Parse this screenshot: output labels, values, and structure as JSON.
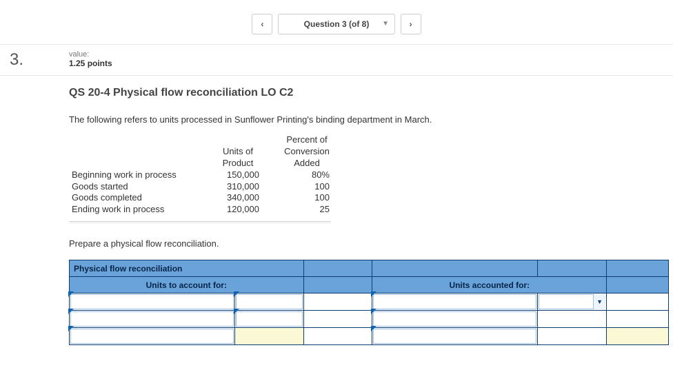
{
  "nav": {
    "prev_icon": "‹",
    "question_label": "Question 3 (of 8)",
    "dropdown_icon": "▼",
    "next_icon": "›"
  },
  "question": {
    "number": "3.",
    "value_label": "value:",
    "points": "1.25 points"
  },
  "title": "QS 20-4 Physical flow reconciliation LO C2",
  "intro": "The following refers to units processed in Sunflower Printing's binding department in March.",
  "data_table": {
    "col1_line1": "Units of",
    "col1_line2": "Product",
    "col2_line1": "Percent of",
    "col2_line2": "Conversion",
    "col2_line3": "Added",
    "rows": [
      {
        "label": "Beginning work in process",
        "units": "150,000",
        "pct": "80%"
      },
      {
        "label": "Goods started",
        "units": "310,000",
        "pct": "100"
      },
      {
        "label": "Goods completed",
        "units": "340,000",
        "pct": "100"
      },
      {
        "label": "Ending work in process",
        "units": "120,000",
        "pct": "25"
      }
    ]
  },
  "prepare": "Prepare a physical flow reconciliation.",
  "recon": {
    "section_title": "Physical flow reconciliation",
    "left_header": "Units to account for:",
    "right_header": "Units accounted for:"
  },
  "chart_data": {
    "type": "table",
    "title": "Units processed — Sunflower Printing binding department, March",
    "columns": [
      "Units of Product",
      "Percent of Conversion Added"
    ],
    "rows": [
      {
        "label": "Beginning work in process",
        "units_of_product": 150000,
        "percent_conversion_added": 80
      },
      {
        "label": "Goods started",
        "units_of_product": 310000,
        "percent_conversion_added": 100
      },
      {
        "label": "Goods completed",
        "units_of_product": 340000,
        "percent_conversion_added": 100
      },
      {
        "label": "Ending work in process",
        "units_of_product": 120000,
        "percent_conversion_added": 25
      }
    ]
  }
}
